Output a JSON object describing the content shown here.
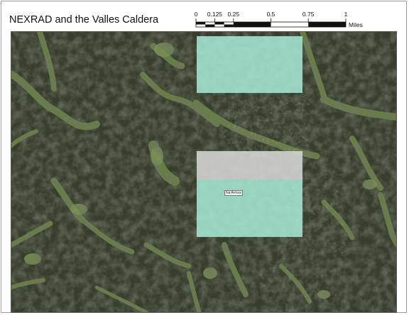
{
  "layout_title": "NEXRAD and the Valles Caldera",
  "scale_bar": {
    "tick_labels": [
      "0",
      "0.125",
      "0.25",
      "0.5",
      "0.75",
      "1"
    ],
    "units": "Miles"
  },
  "map": {
    "basemap": "aerial imagery of forested terrain with meadow clearings",
    "overlays": [
      {
        "name": "upper-rectangle",
        "fill_color": "#a8ecd8",
        "opacity": 0.85
      },
      {
        "name": "middle-rectangle-gray",
        "fill_color": "#d6d6d6",
        "opacity": 0.88
      },
      {
        "name": "lower-rectangle",
        "fill_color": "#a8ecd8",
        "opacity": 0.85
      }
    ],
    "callout_label": "Na'Armsa"
  },
  "colors": {
    "forest_dark": "#2f3326",
    "meadow_green": "#6f8a4a",
    "frame_border": "#9a9a9a"
  }
}
